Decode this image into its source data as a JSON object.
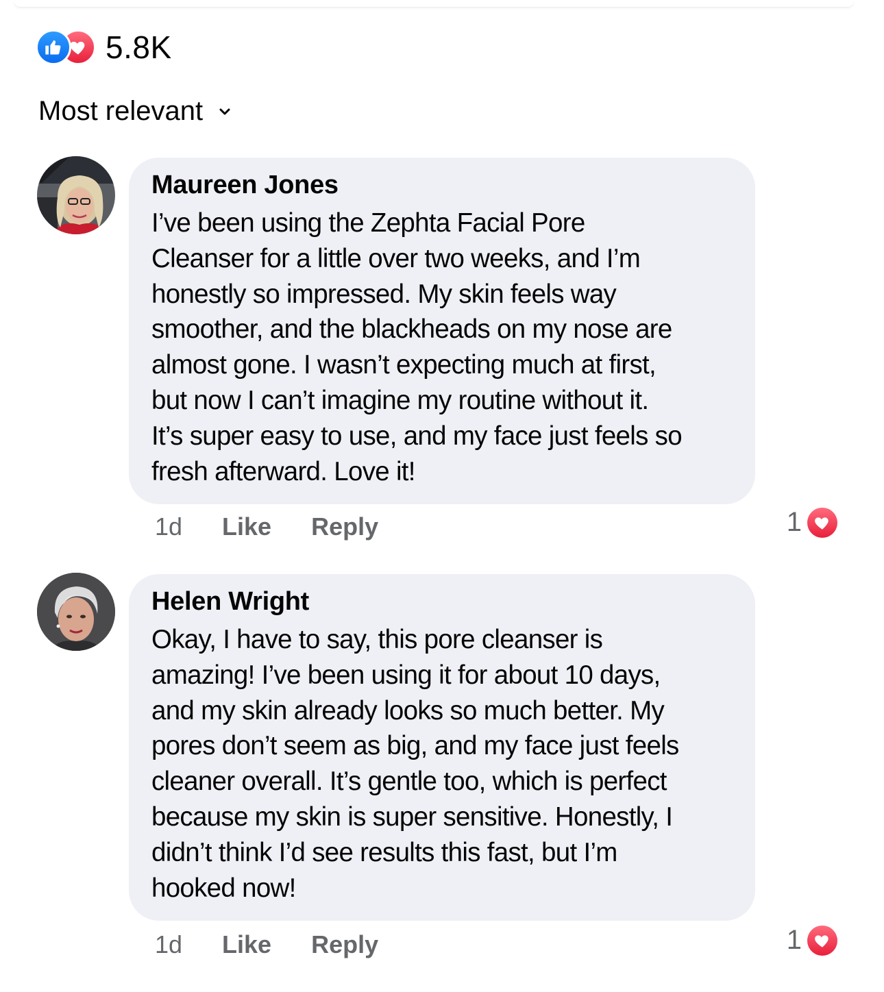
{
  "reactions": {
    "count": "5.8K",
    "types": [
      "like-icon",
      "love-icon"
    ]
  },
  "sort": {
    "label": "Most relevant"
  },
  "comments": [
    {
      "author": "Maureen Jones",
      "text": "I’ve been using the Zephta Facial Pore\nCleanser for a little over two weeks, and I’m\nhonestly so impressed. My skin feels way\nsmoother, and the blackheads on my nose are\nalmost gone. I wasn’t expecting much at first,\nbut now I can’t imagine my routine without it.\nIt’s super easy to use, and my face just feels so\nfresh afterward. Love it!",
      "time": "1d",
      "like_label": "Like",
      "reply_label": "Reply",
      "reaction_count": "1"
    },
    {
      "author": "Helen Wright",
      "text": "Okay, I have to say, this pore cleanser is\namazing! I’ve been using it for about 10 days,\nand my skin already looks so much better. My\npores don’t seem as big, and my face just feels\ncleaner overall. It’s gentle too, which is perfect\nbecause my skin is super sensitive. Honestly, I\ndidn’t think I’d see results this fast, but I’m\nhooked now!",
      "time": "1d",
      "like_label": "Like",
      "reply_label": "Reply",
      "reaction_count": "1"
    }
  ],
  "colors": {
    "like_blue": "#0a6cf0",
    "love_red": "#e8203b",
    "bubble_bg": "#eff0f5",
    "meta_gray": "#65676b"
  }
}
